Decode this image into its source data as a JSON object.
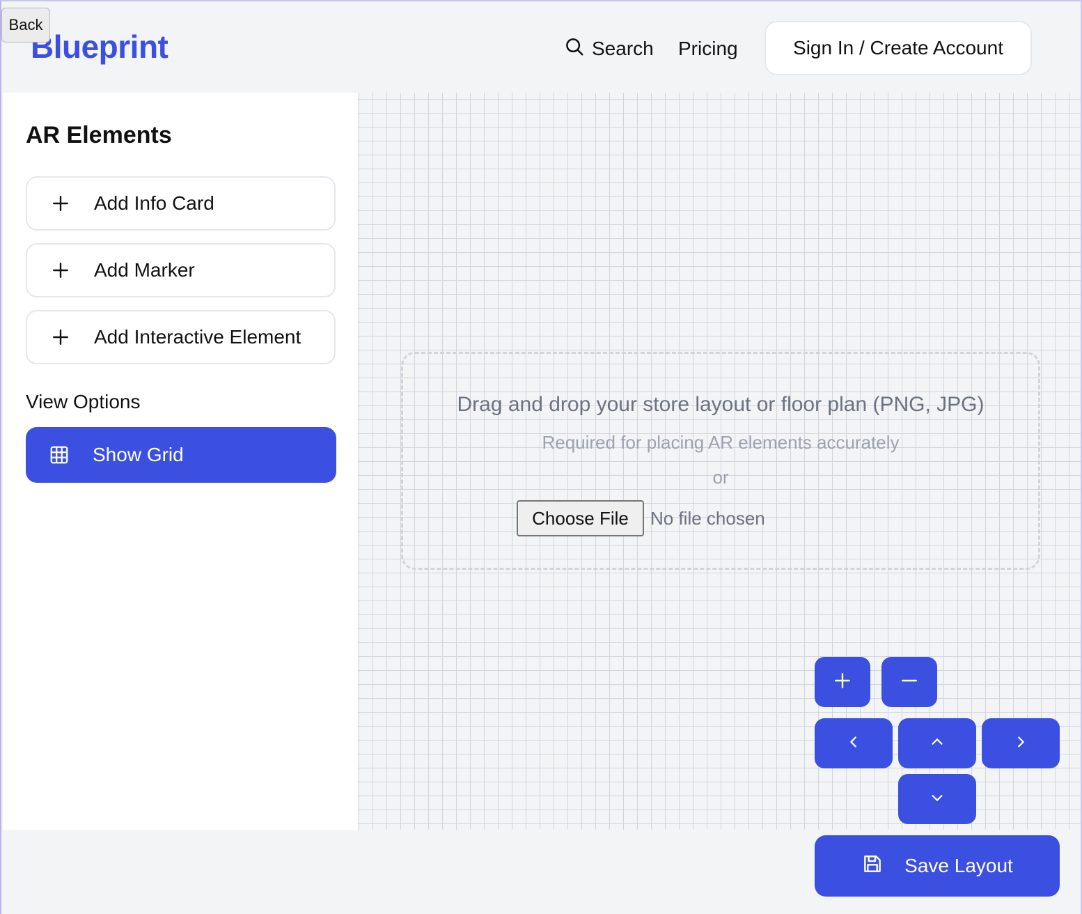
{
  "back_button": {
    "label": "Back"
  },
  "header": {
    "brand": "Blueprint",
    "nav": {
      "search_label": "Search",
      "pricing_label": "Pricing",
      "signin_label": "Sign In / Create Account"
    }
  },
  "sidebar": {
    "title": "AR Elements",
    "add_buttons": [
      {
        "label": "Add Info Card",
        "icon": "plus-icon"
      },
      {
        "label": "Add Marker",
        "icon": "plus-icon"
      },
      {
        "label": "Add Interactive Element",
        "icon": "plus-icon"
      }
    ],
    "view_options_label": "View Options",
    "show_grid_label": "Show Grid",
    "show_grid_active": true
  },
  "dropzone": {
    "main_text": "Drag and drop your store layout or floor plan (PNG, JPG)",
    "sub_text": "Required for placing AR elements accurately",
    "or_text": "or",
    "choose_file_label": "Choose File",
    "no_file_text": "No file chosen"
  },
  "controls": {
    "zoom_in_icon": "plus-icon",
    "zoom_out_icon": "minus-icon",
    "pan_left_icon": "chevron-left-icon",
    "pan_up_icon": "chevron-up-icon",
    "pan_right_icon": "chevron-right-icon",
    "pan_down_icon": "chevron-down-icon"
  },
  "save_button": {
    "label": "Save Layout",
    "icon": "save-icon"
  },
  "colors": {
    "accent": "#3b50e0",
    "background": "#f3f4f6",
    "grid_line": "#d1d5db"
  }
}
